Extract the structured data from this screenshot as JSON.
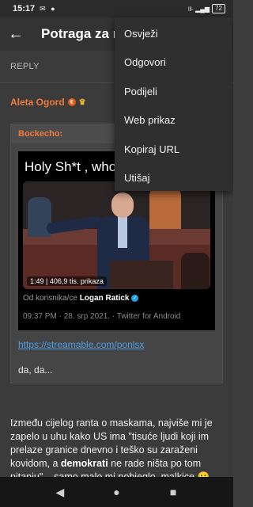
{
  "status_bar": {
    "time": "15:17",
    "battery": "72",
    "notif_icons": "✉ ●",
    "right_icons": "⊪ ▂▄▆"
  },
  "app_bar": {
    "back_icon": "back-arrow-icon",
    "title": "Potraga za razgovorom"
  },
  "reply_label": "REPLY",
  "post": {
    "author": "Aleta Ogord",
    "badge_1": "€",
    "badge_2": "♛",
    "quote": {
      "author": "Bockecho:",
      "tweet": {
        "text": "Holy Sh*t , who is this",
        "video_duration": "1:49",
        "video_views": "406,9 tis. prikaza",
        "from_prefix": "Od korisnika/ce",
        "from_user": "Logan Ratick",
        "meta": "09:37 PM · 28. srp 2021. · Twitter for Android"
      },
      "link": "https://streamable.com/ponlsx",
      "text": "da, da..."
    },
    "body_part1": "Između cijelog ranta o maskama, najviše mi je zapelo u uhu kako US ima \"tisuće ljudi koji im prelaze granice dnevno i teško su zaraženi kovidom, a ",
    "body_bold": "demokrati",
    "body_part2": " ne rade ništa po tom pitanju\"... samo malo mi pobjeglo, malkice 😀"
  },
  "menu": {
    "items": [
      "Osvježi",
      "Odgovori",
      "Podijeli",
      "Web prikaz",
      "Kopiraj URL",
      "Utišaj"
    ]
  },
  "nav": {
    "back": "◀",
    "home": "●",
    "recents": "■"
  }
}
